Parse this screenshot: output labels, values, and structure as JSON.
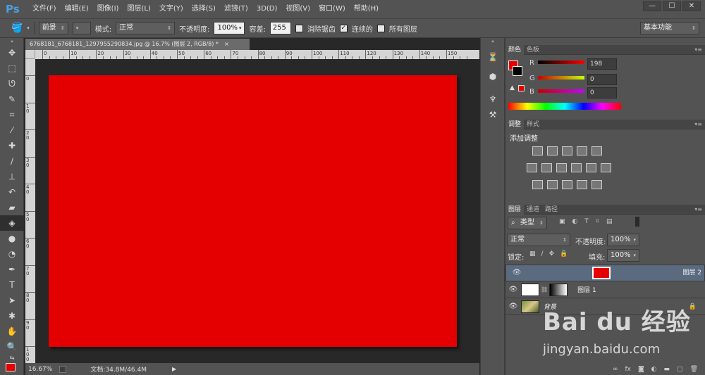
{
  "app": {
    "logo": "Ps"
  },
  "menu": [
    "文件(F)",
    "编辑(E)",
    "图像(I)",
    "图层(L)",
    "文字(Y)",
    "选择(S)",
    "滤镜(T)",
    "3D(D)",
    "视图(V)",
    "窗口(W)",
    "帮助(H)"
  ],
  "window_buttons": {
    "minimize": "—",
    "restore": "☐",
    "close": "✕"
  },
  "options": {
    "fill_source": "前景",
    "mode_label": "模式:",
    "mode_value": "正常",
    "opacity_label": "不透明度:",
    "opacity_value": "100%",
    "tolerance_label": "容差:",
    "tolerance_value": "255",
    "antialias_label": "消除锯齿",
    "contiguous_label": "连续的",
    "all_layers_label": "所有图层",
    "workspace": "基本功能"
  },
  "document": {
    "tab_title": "6768181_6768181_1297955290834.jpg @ 16.7% (图层 2, RGB/8) *",
    "close": "×",
    "canvas_color": "#e40000",
    "zoom": "16.67%",
    "doc_size": "文档:34.8M/46.4M"
  },
  "ruler": {
    "h_labels": [
      "0",
      "10",
      "20",
      "30",
      "40",
      "50",
      "60",
      "70",
      "80",
      "90",
      "100",
      "110",
      "120",
      "130",
      "140",
      "150"
    ],
    "v_labels": [
      "0",
      "10",
      "20",
      "30",
      "40",
      "50",
      "60",
      "70",
      "80",
      "90",
      "100"
    ]
  },
  "color_panel": {
    "tabs": [
      "颜色",
      "色板"
    ],
    "r_label": "R",
    "g_label": "G",
    "b_label": "B",
    "r": "198",
    "g": "0",
    "b": "0",
    "foreground": "#e40000"
  },
  "adjust_panel": {
    "tabs": [
      "调整",
      "样式"
    ],
    "title": "添加调整"
  },
  "layers_panel": {
    "tabs": [
      "图层",
      "通道",
      "路径"
    ],
    "filter_kind": "类型",
    "blend_mode": "正常",
    "opacity_label": "不透明度:",
    "opacity_value": "100%",
    "lock_label": "锁定:",
    "fill_label": "填充:",
    "fill_value": "100%",
    "layers": [
      {
        "name": "图层 2",
        "selected": true
      },
      {
        "name": "图层 1",
        "selected": false
      },
      {
        "name": "背景",
        "selected": false
      }
    ]
  },
  "watermark": {
    "brand": "Bai du 经验",
    "url": "jingyan.baidu.com"
  }
}
